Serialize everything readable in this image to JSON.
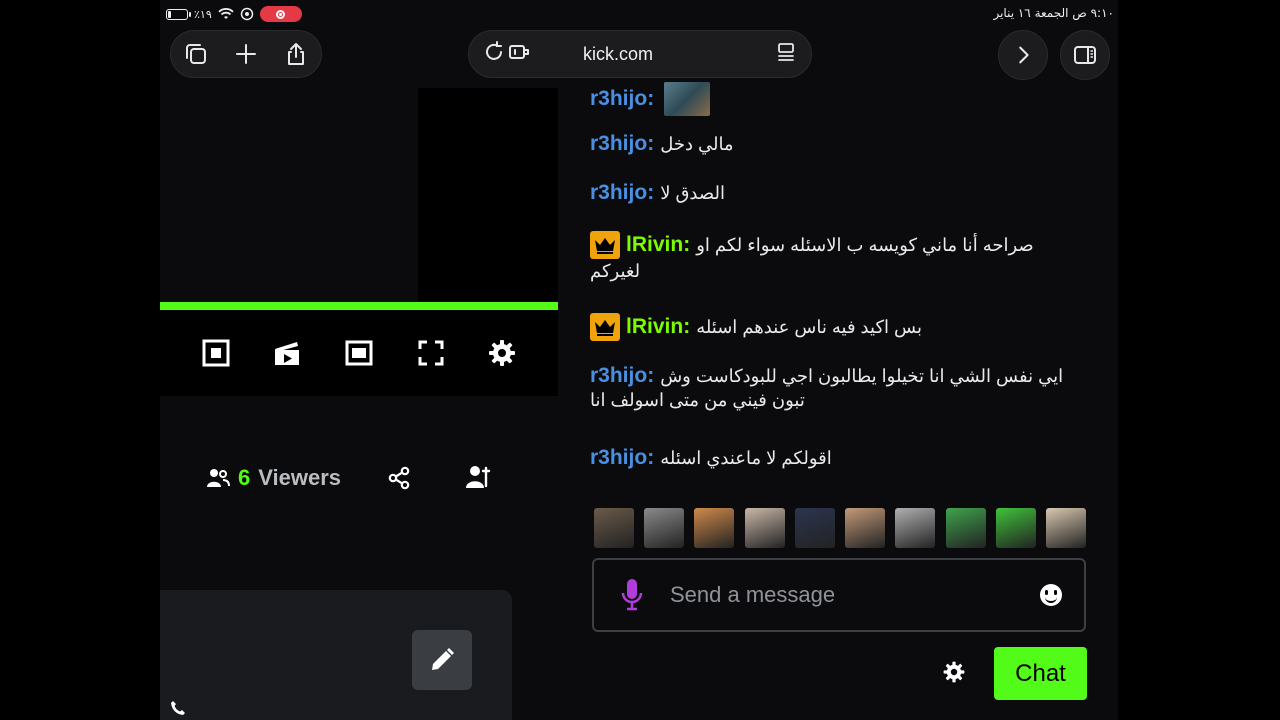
{
  "status_bar": {
    "battery_percent": "٪١٩",
    "battery_level": 0.19,
    "datetime": "٩:١٠ ص  الجمعة ١٦ يناير"
  },
  "browser": {
    "url": "kick.com"
  },
  "stream": {
    "progress": 1.0,
    "viewer_count": "6",
    "viewer_label": "Viewers"
  },
  "chat": {
    "messages": [
      {
        "user": "r3hijo",
        "separator": ":",
        "text": "",
        "user_color": "blue",
        "badge": "",
        "has_emote": true
      },
      {
        "user": "r3hijo",
        "separator": ":",
        "text": "مالي دخل",
        "user_color": "blue",
        "badge": ""
      },
      {
        "user": "r3hijo",
        "separator": ":",
        "text": "الصدق لا",
        "user_color": "blue",
        "badge": ""
      },
      {
        "user": "lRivin",
        "separator": ":",
        "text": "صراحه أنا ماني كويسه ب الاسئله سواء لكم او",
        "text2": "لغيركم",
        "user_color": "green",
        "badge": "crown"
      },
      {
        "user": "lRivin",
        "separator": ":",
        "text": "بس اكيد فيه ناس عندهم اسئله",
        "user_color": "green",
        "badge": "crown"
      },
      {
        "user": "r3hijo",
        "separator": ":",
        "text": "ايي نفس الشي انا تخيلوا يطالبون اجي للبودكاست وش",
        "text2": "تبون فيني من متى اسولف انا",
        "user_color": "blue",
        "badge": ""
      },
      {
        "user": "r3hijo",
        "separator": ":",
        "text": "اقولكم لا ماعندي اسئله",
        "user_color": "blue",
        "badge": ""
      }
    ],
    "emotes": [
      {
        "name": "emote-1",
        "color": "#6b5a4a"
      },
      {
        "name": "emote-2",
        "color": "#8a8a8a"
      },
      {
        "name": "emote-3",
        "color": "#d08a4a"
      },
      {
        "name": "emote-4",
        "color": "#c9b8a8"
      },
      {
        "name": "emote-5",
        "color": "#2c3550"
      },
      {
        "name": "emote-6",
        "color": "#c49a7a"
      },
      {
        "name": "emote-7",
        "color": "#b0b0b0"
      },
      {
        "name": "emote-8",
        "color": "#3fa34d"
      },
      {
        "name": "emote-9",
        "color": "#3fc33a"
      },
      {
        "name": "emote-10",
        "color": "#d8c8b0"
      }
    ],
    "input_placeholder": "Send a message",
    "send_label": "Chat"
  },
  "colors": {
    "accent": "#53fc18",
    "user_blue": "#4a90e2",
    "user_green": "#7cfc00",
    "crown_badge": "#f0a30a"
  }
}
